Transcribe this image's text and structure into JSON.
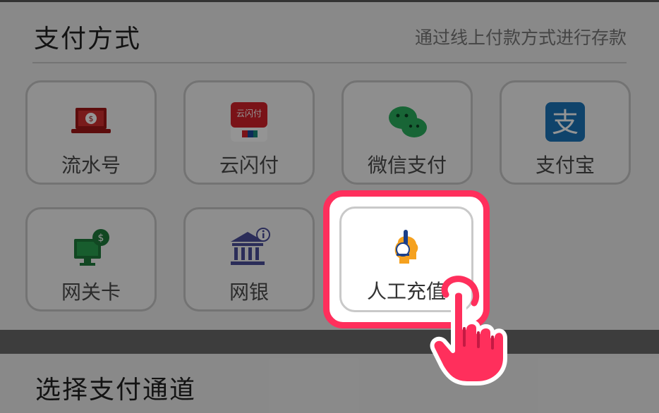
{
  "header": {
    "title": "支付方式",
    "subtitle": "通过线上付款方式进行存款"
  },
  "methods": [
    {
      "label": "流水号",
      "icon": "laptop-dollar-icon"
    },
    {
      "label": "云闪付",
      "icon": "unionpay-quickpass-icon"
    },
    {
      "label": "微信支付",
      "icon": "wechat-icon"
    },
    {
      "label": "支付宝",
      "icon": "alipay-icon"
    },
    {
      "label": "网关卡",
      "icon": "monitor-dollar-icon"
    },
    {
      "label": "网银",
      "icon": "bank-icon"
    },
    {
      "label": "人工充值",
      "icon": "headset-agent-icon",
      "highlighted": true
    }
  ],
  "section2": {
    "title": "选择支付通道"
  },
  "colors": {
    "highlight": "#ff2f5c",
    "agent_orange": "#f5a11f"
  }
}
